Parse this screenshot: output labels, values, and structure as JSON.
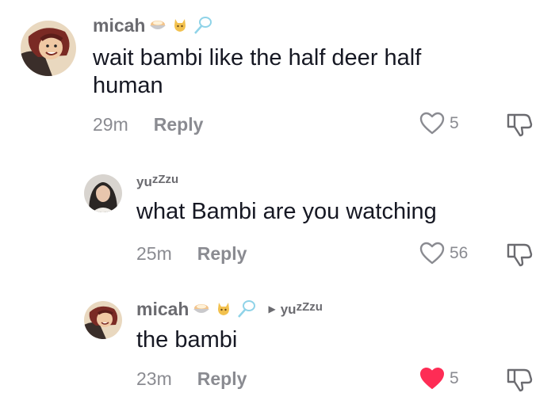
{
  "comments": [
    {
      "username": "micah",
      "badges": [
        "bowl-icon",
        "cat-icon",
        "racket-icon"
      ],
      "text": "wait bambi like the half deer half human",
      "time": "29m",
      "reply_label": "Reply",
      "likes": "5",
      "liked": false
    },
    {
      "username_main": "yu",
      "username_zz": "zZzu",
      "text": "what Bambi are you watching",
      "time": "25m",
      "reply_label": "Reply",
      "likes": "56",
      "liked": false
    },
    {
      "username": "micah",
      "badges": [
        "bowl-icon",
        "cat-icon",
        "racket-icon"
      ],
      "reply_to_main": "yu",
      "reply_to_zz": "zZzu",
      "text": "the bambi",
      "time": "23m",
      "reply_label": "Reply",
      "likes": "5",
      "liked": true
    }
  ],
  "colors": {
    "liked_heart": "#fe2c55",
    "muted": "#8a8b91",
    "username": "#6b6b70"
  }
}
